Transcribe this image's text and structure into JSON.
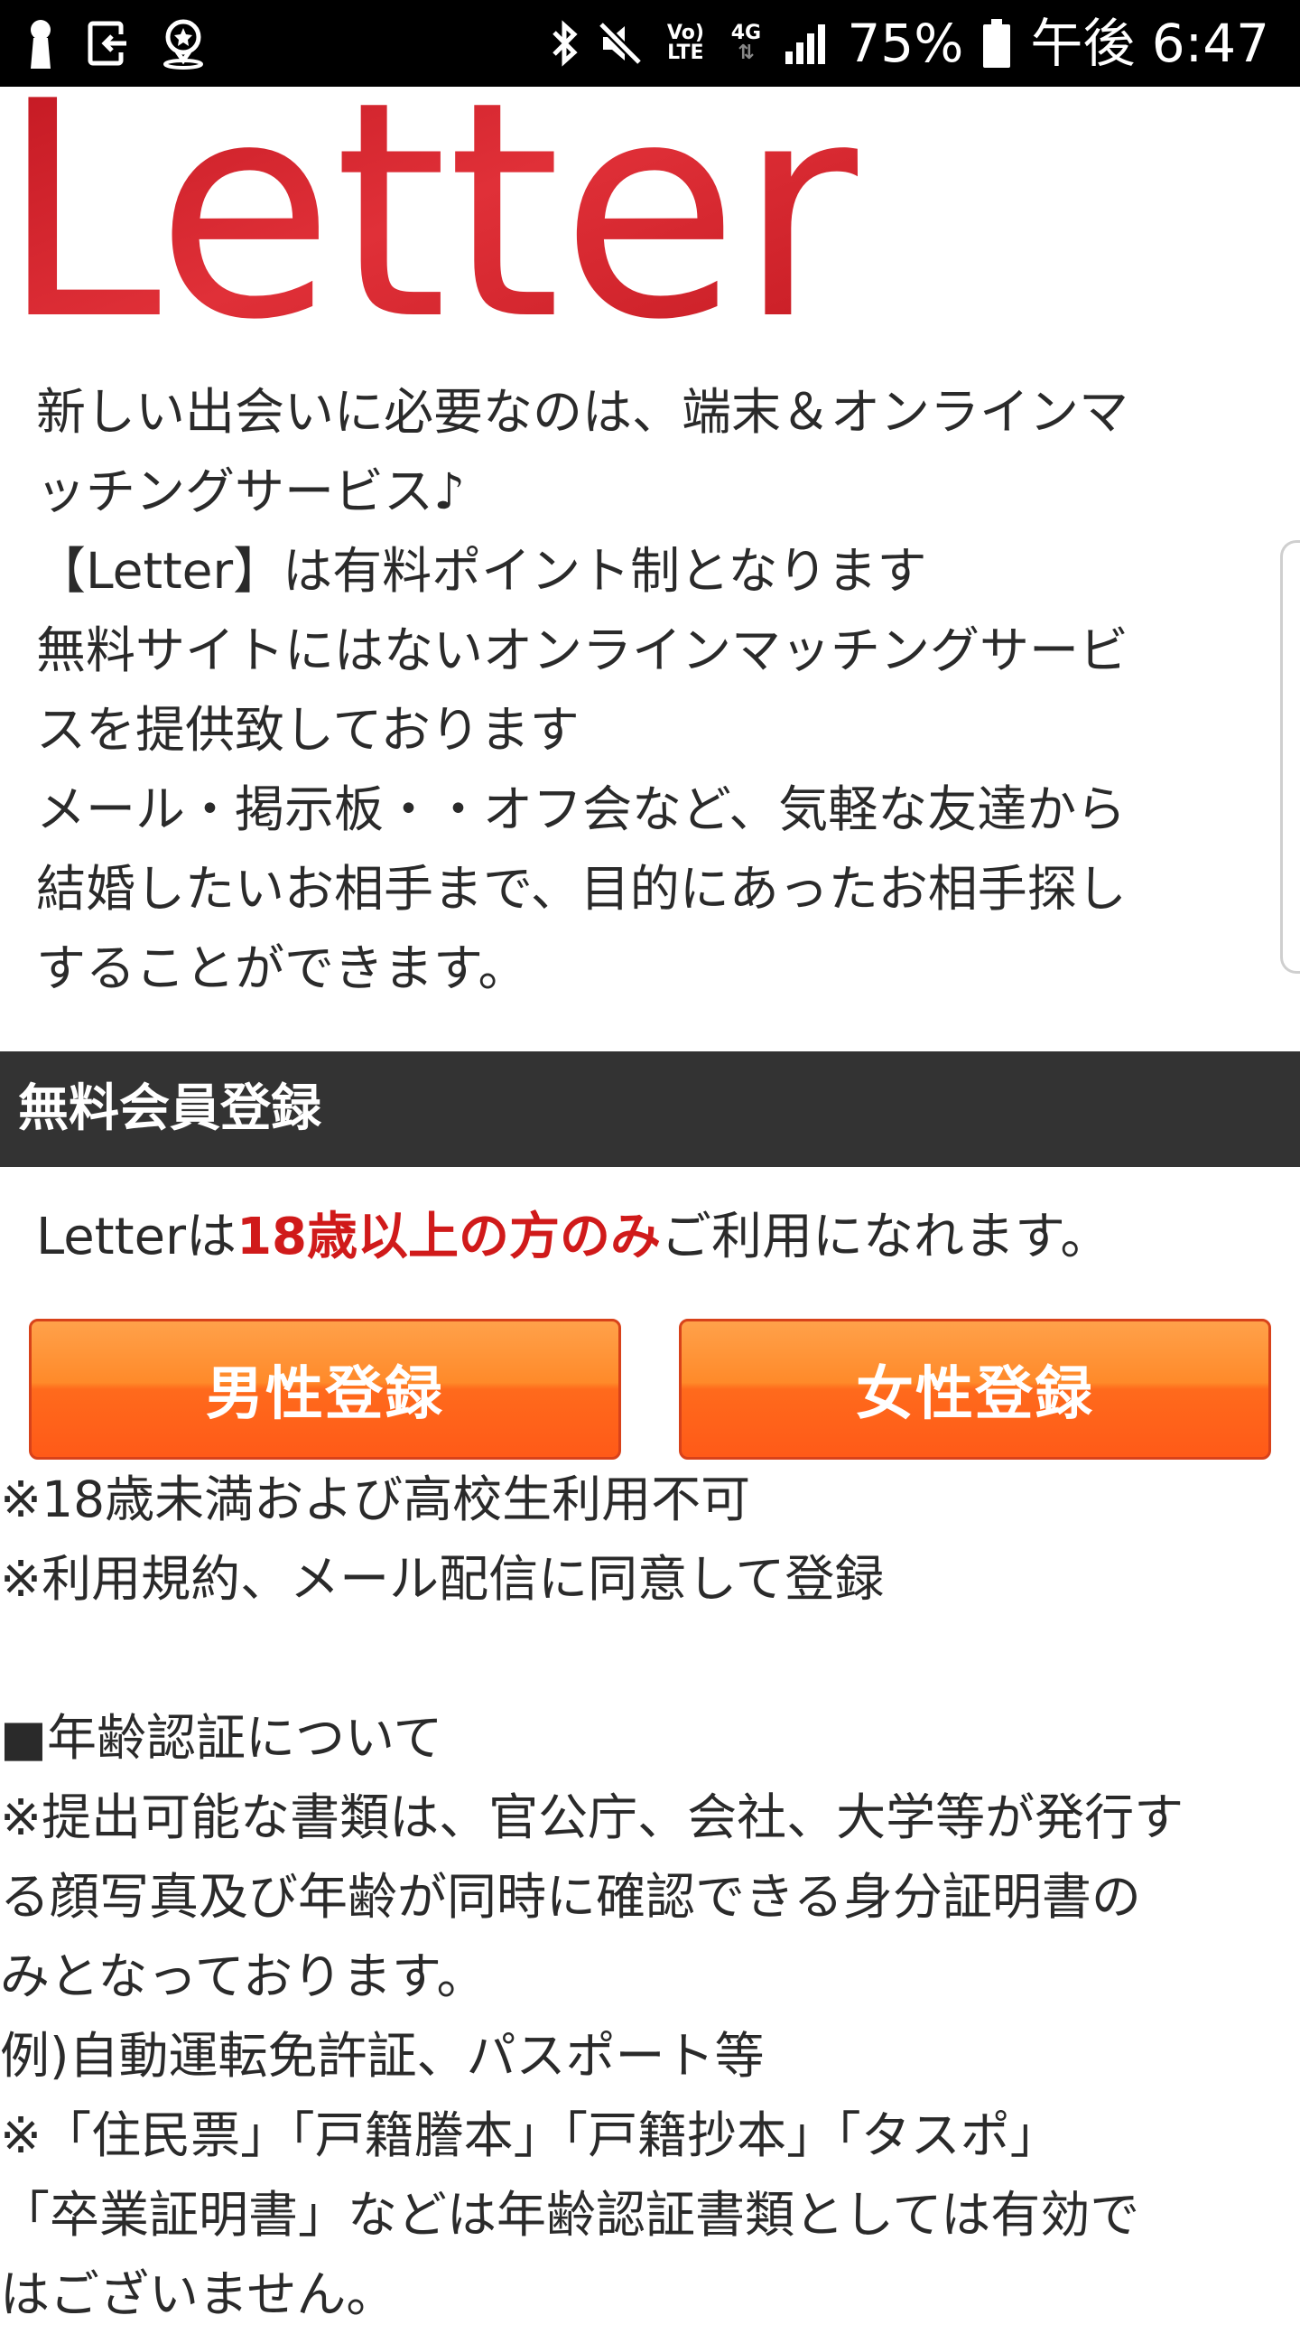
{
  "status_bar": {
    "volte_top": "Vo)",
    "volte_bottom": "LTE",
    "network": "4G",
    "battery": "75%",
    "time": "午後 6:47",
    "icons": [
      "lock-icon",
      "download-icon",
      "location-star-icon",
      "bluetooth-icon",
      "mute-icon",
      "volte-icon",
      "network-4g-icon",
      "signal-icon",
      "battery-icon"
    ]
  },
  "logo": {
    "text": "Letter",
    "color": "#d42025"
  },
  "intro": {
    "lines": [
      "新しい出会いに必要なのは、端末＆オンラインマ",
      "ッチングサービス♪",
      "【Letter】は有料ポイント制となります",
      "無料サイトにはないオンラインマッチングサービ",
      "スを提供致しております",
      "メール・掲示板・・オフ会など、気軽な友達から",
      "結婚したいお相手まで、目的にあったお相手探し",
      "することができます。"
    ]
  },
  "registration": {
    "header": "無料会員登録",
    "age_prefix": "Letterは",
    "age_emphasis": "18歳以上の方のみ",
    "age_suffix": "ご利用になれます。",
    "male_button": "男性登録",
    "female_button": "女性登録",
    "emphasis_color": "#d01a1a"
  },
  "notes": {
    "under18": "※18歳未満および高校生利用不可",
    "agree": "※利用規約、メール配信に同意して登録",
    "age_verification_title": "■年齢認証について",
    "lines": [
      "※提出可能な書類は、官公庁、会社、大学等が発行す",
      "る顔写真及び年齢が同時に確認できる身分証明書の",
      "みとなっております。",
      "例)自動運転免許証、パスポート等",
      "※「住民票」「戸籍謄本」「戸籍抄本」「タスポ」",
      "「卒業証明書」などは年齢認証書類としては有効で",
      "はございません。"
    ]
  }
}
